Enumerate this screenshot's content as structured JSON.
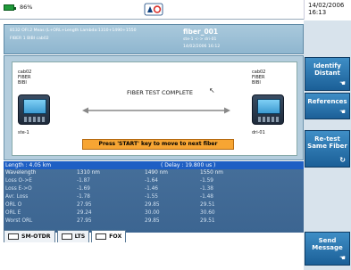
{
  "status": {
    "battery": "86%",
    "date": "14/02/2006",
    "time": "16:13"
  },
  "header": {
    "line1": "8132 OFI.2    Meas (L+ORL+Length  Lambda:1310+1490+1550",
    "line2": "FIBER  1  BIBI  cab02",
    "fiber_name": "fiber_001",
    "ends": "ste-1 <-> dri-01",
    "timestamp": "14/02/2006  16:12"
  },
  "diagram": {
    "left_labels": [
      "cab02",
      "FIBER",
      "BIBI"
    ],
    "right_labels": [
      "cab02",
      "FIBER",
      "BIBI"
    ],
    "left_end": "ste-1",
    "right_end": "dri-01",
    "status": "FIBER TEST COMPLETE",
    "prompt": "Press 'START' key to move to next fiber"
  },
  "results": {
    "length": "Length : 4.05 km",
    "delay": "( Delay : 19.800 us )",
    "columns": [
      "Wavelength",
      "1310 nm",
      "1490 nm",
      "1550 nm"
    ],
    "rows": [
      [
        "Loss O->E",
        "-1.87",
        "-1.64",
        "-1.59"
      ],
      [
        "Loss E->O",
        "-1.69",
        "-1.46",
        "-1.38"
      ],
      [
        "Avr. Loss",
        "-1.78",
        "-1.55",
        "-1.48"
      ],
      [
        "ORL O",
        "27.95",
        "29.85",
        "29.51"
      ],
      [
        "ORL E",
        "29.24",
        "30.00",
        "30.60"
      ],
      [
        "Worst ORL",
        "27.95",
        "29.85",
        "29.51"
      ]
    ]
  },
  "tabs": [
    "SM-OTDR",
    "LTS",
    "FOX"
  ],
  "sidebar": {
    "identify_distant": "Identify Distant",
    "references": "References",
    "retest_same_fiber": "Re-test Same Fiber",
    "send_message": "Send Message"
  },
  "colors": {
    "accent": "#1e5fc4",
    "panel": "#466f9a",
    "button": "#1b5f97",
    "prompt": "#f7a533"
  }
}
